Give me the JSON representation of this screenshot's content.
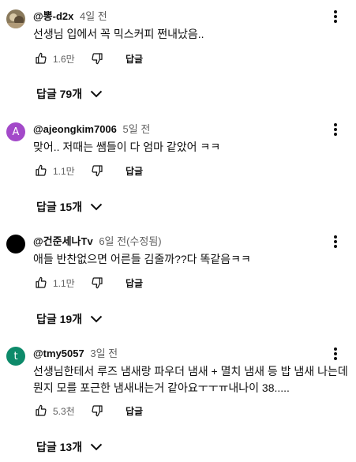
{
  "comments": [
    {
      "author": "@뽕-d2x",
      "time": "4일 전",
      "text": [
        "선생님 입에서 꼭 믹스커피 쩐내났음.."
      ],
      "likes": "1.6만",
      "reply_label": "답글",
      "replies_label": "답글 79개",
      "avatar": {
        "type": "photo",
        "color": "#8a7a5c"
      }
    },
    {
      "author": "@ajeongkim7006",
      "time": "5일 전",
      "text": [
        "맞어.. 저때는 쌤들이 다 엄마 같았어 ㅋㅋ"
      ],
      "likes": "1.1만",
      "reply_label": "답글",
      "replies_label": "답글 15개",
      "avatar": {
        "type": "letter",
        "letter": "A",
        "color": "#a349c9"
      }
    },
    {
      "author": "@건준세나Tv",
      "time": "6일 전(수정됨)",
      "text": [
        "애들 반찬없으면 어른들 김줄까??다 똑같음ㅋㅋ"
      ],
      "likes": "1.1만",
      "reply_label": "답글",
      "replies_label": "답글 19개",
      "avatar": {
        "type": "solid",
        "color": "#000000"
      }
    },
    {
      "author": "@tmy5057",
      "time": "3일 전",
      "text": [
        "선생님한테서 루즈 냄새랑 파우더 냄새 + 멸치 냄새 등 밥 냄새 나는데",
        "뭔지 모를 포근한 냄새내는거 같아요ㅜㅜㅠ내나이 38....."
      ],
      "likes": "5.3천",
      "reply_label": "답글",
      "replies_label": "답글 13개",
      "avatar": {
        "type": "letter",
        "letter": "t",
        "color": "#0d8a6a"
      }
    }
  ],
  "icons": {
    "like": "thumbs-up-icon",
    "dislike": "thumbs-down-icon",
    "more": "more-vertical-icon",
    "expand": "chevron-down-icon"
  }
}
